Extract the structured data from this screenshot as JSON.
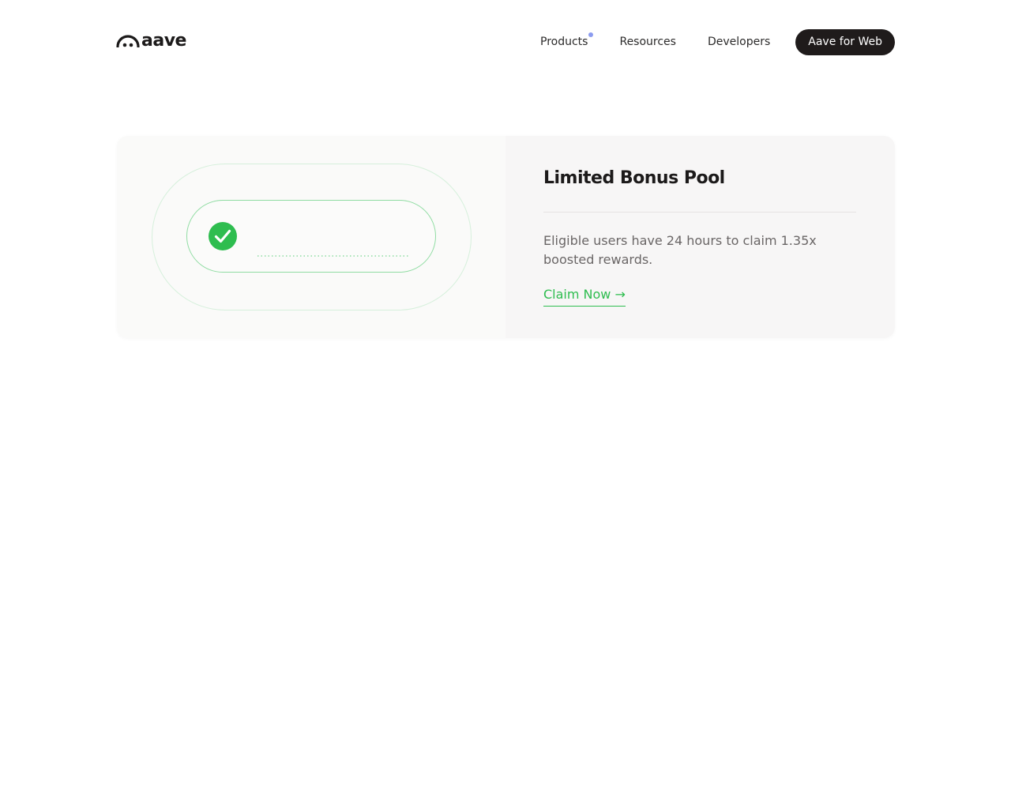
{
  "brand": {
    "name": "aave",
    "logo_icon": "aave-ghost-icon"
  },
  "nav": {
    "items": [
      {
        "label": "Products",
        "has_indicator": true
      },
      {
        "label": "Resources"
      },
      {
        "label": "Developers"
      }
    ],
    "cta_label": "Aave for Web"
  },
  "promo": {
    "title": "Limited Bonus Pool",
    "description": "Eligible users have 24 hours to claim 1.35x boosted rewards.",
    "link_label": "Claim Now →",
    "status_icon": "check-circle-icon"
  },
  "colors": {
    "accent_green": "#2ebd4f",
    "dark": "#1f1b1b",
    "indicator": "#8b9bf0"
  }
}
